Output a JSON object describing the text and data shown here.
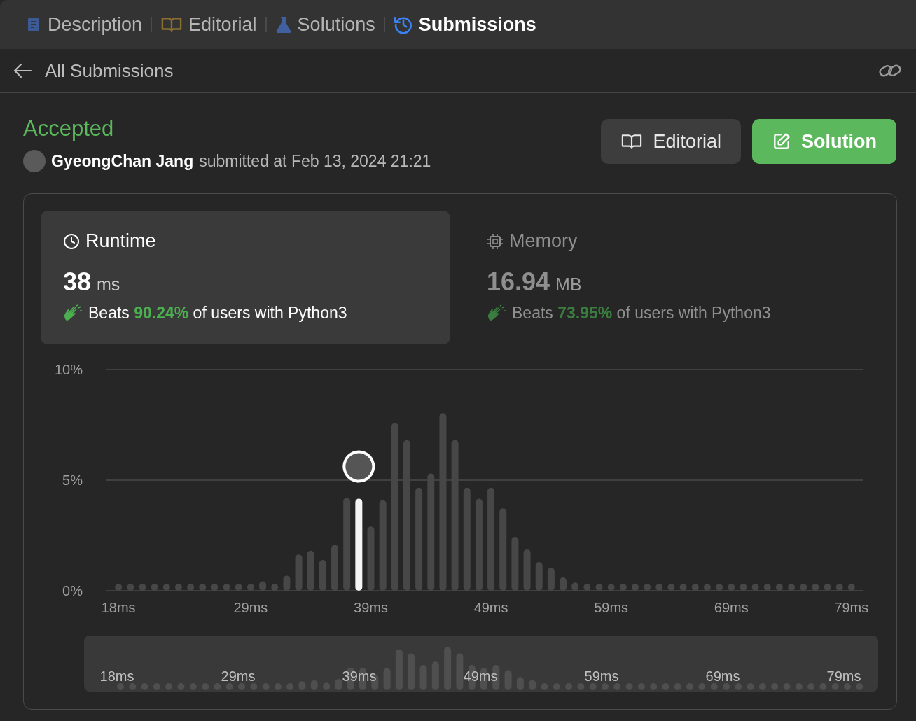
{
  "tabs": [
    {
      "label": "Description",
      "kind": "document",
      "selected": false
    },
    {
      "label": "Editorial",
      "kind": "book",
      "selected": false
    },
    {
      "label": "Solutions",
      "kind": "flask",
      "selected": false
    },
    {
      "label": "Submissions",
      "kind": "history",
      "selected": true
    }
  ],
  "header": {
    "back_label": "All Submissions"
  },
  "submission": {
    "status": "Accepted",
    "user": "GyeongChan Jang",
    "submitted_text": "submitted at Feb 13, 2024 21:21"
  },
  "buttons": [
    {
      "label": "Editorial",
      "kind": "editorial"
    },
    {
      "label": "Solution",
      "kind": "solution"
    }
  ],
  "stats": [
    {
      "kind": "runtime",
      "title": "Runtime",
      "value": "38",
      "unit": "ms",
      "beats_prefix": "Beats",
      "percent": "90.24%",
      "beats_suffix": "of users with Python3",
      "selected": true
    },
    {
      "kind": "memory",
      "title": "Memory",
      "value": "16.94",
      "unit": "MB",
      "beats_prefix": "Beats",
      "percent": "73.95%",
      "beats_suffix": "of users with Python3",
      "selected": false
    }
  ],
  "chart_data": {
    "type": "bar",
    "ylim": [
      0,
      10
    ],
    "xlim": [
      17,
      80
    ],
    "yticks": [
      {
        "value": 0,
        "label": "0%"
      },
      {
        "value": 5,
        "label": "5%"
      },
      {
        "value": 10,
        "label": "10%"
      }
    ],
    "x": [
      18,
      19,
      20,
      21,
      22,
      23,
      24,
      25,
      26,
      27,
      28,
      29,
      30,
      31,
      32,
      33,
      34,
      35,
      36,
      37,
      38,
      39,
      40,
      41,
      42,
      43,
      44,
      45,
      46,
      47,
      48,
      49,
      50,
      51,
      52,
      53,
      54,
      55,
      56,
      57,
      58,
      59,
      60,
      61,
      62,
      63,
      64,
      65,
      66,
      67,
      68,
      69,
      70,
      71,
      72,
      73,
      74,
      75,
      76,
      77,
      78,
      79
    ],
    "xticks": [
      {
        "value": 18,
        "label": "18ms"
      },
      {
        "value": 29,
        "label": "29ms"
      },
      {
        "value": 39,
        "label": "39ms"
      },
      {
        "value": 49,
        "label": "49ms"
      },
      {
        "value": 59,
        "label": "59ms"
      },
      {
        "value": 69,
        "label": "69ms"
      },
      {
        "value": 79,
        "label": "79ms"
      }
    ],
    "values": [
      0.3,
      0.3,
      0.3,
      0.3,
      0.3,
      0.3,
      0.3,
      0.3,
      0.3,
      0.3,
      0.3,
      0.3,
      0.43,
      0.3,
      0.68,
      1.64,
      1.81,
      1.39,
      2.07,
      4.2,
      4.16,
      2.9,
      4.1,
      7.58,
      6.81,
      4.66,
      5.3,
      8.03,
      6.81,
      4.66,
      4.16,
      4.66,
      3.73,
      2.44,
      1.87,
      1.3,
      1.04,
      0.6,
      0.37,
      0.3,
      0.3,
      0.3,
      0.3,
      0.3,
      0.3,
      0.3,
      0.3,
      0.3,
      0.3,
      0.3,
      0.3,
      0.3,
      0.3,
      0.3,
      0.3,
      0.3,
      0.3,
      0.3,
      0.3,
      0.3,
      0.3,
      0.3
    ]
  },
  "overview": {
    "tick_labels": [
      "18ms",
      "29ms",
      "39ms",
      "49ms",
      "59ms",
      "69ms",
      "79ms"
    ]
  }
}
